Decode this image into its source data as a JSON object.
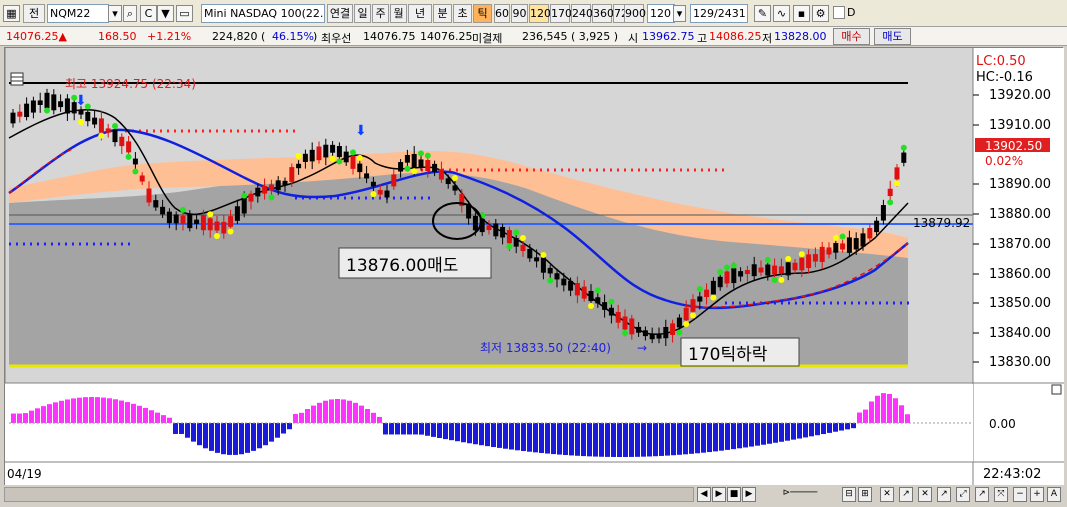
{
  "toolbar": {
    "label_jeon": "전",
    "symbol": "NQM22",
    "product_name": "Mini NASDAQ 100(22.0",
    "periods": [
      "연결",
      "일",
      "주",
      "월",
      "년",
      "분",
      "초",
      "틱"
    ],
    "tick_sizes": [
      "60",
      "90",
      "120",
      "170",
      "240",
      "360",
      "720",
      "900"
    ],
    "tick_selected": "120",
    "tick_input": "120",
    "count": "129/2431",
    "checkbox_label": "D"
  },
  "quote": {
    "price": "14076.25",
    "change": "168.50",
    "change_pct": "+1.21%",
    "volume": "224,820 (",
    "volume_pct": "46.15%",
    "volume_close": ")",
    "best_label": "최우선",
    "bid": "14076.75",
    "ask": "14076.25",
    "open_int_label": "미결제",
    "open_int": "236,545 ( 3,925 )",
    "open_label": "시",
    "open": "13962.75",
    "high_label": "고",
    "high": "14086.25",
    "low_label": "저",
    "low": "13828.00",
    "buy_button": "매수",
    "sell_button": "매도"
  },
  "chart": {
    "y_axis_labels": [
      "13920.00",
      "13910.00",
      "13890.00",
      "13880.00",
      "13870.00",
      "13860.00",
      "13850.00",
      "13840.00",
      "13830.00"
    ],
    "lc_label": "LC:0.50",
    "hc_label": "HC:-0.16",
    "current_price": "13902.50",
    "current_pct": "0.02%",
    "hline_price": "13879.92",
    "high_annotation": "최고 13924.75 (22:34)",
    "low_annotation": "최저 13833.50 (22:40)",
    "sell_box": "13876.00매도",
    "drop_box": "170틱하락",
    "osc_label": "0.00",
    "date_label": "04/19",
    "time_label": "22:43:02"
  },
  "colors": {
    "up_candle": "#e01010",
    "down_candle": "#000000",
    "ma_blue": "#1020e0",
    "band_orange": "#ffbf94",
    "band_gray": "#9a9a9a",
    "osc_pos": "#ff33ff",
    "osc_neg": "#1a1ad8"
  }
}
